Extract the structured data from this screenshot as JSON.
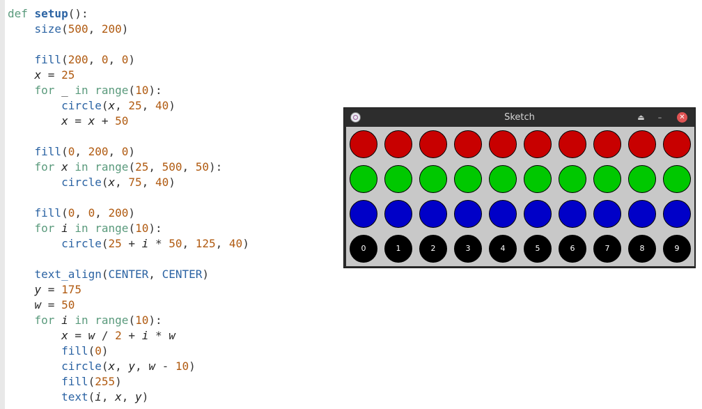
{
  "editor": {
    "lines": [
      [
        {
          "t": "def ",
          "c": "kw"
        },
        {
          "t": "setup",
          "c": "fn"
        },
        {
          "t": "():",
          "c": "plain"
        }
      ],
      [
        {
          "t": "    ",
          "c": "plain"
        },
        {
          "t": "size",
          "c": "bi"
        },
        {
          "t": "(",
          "c": "plain"
        },
        {
          "t": "500",
          "c": "num"
        },
        {
          "t": ", ",
          "c": "plain"
        },
        {
          "t": "200",
          "c": "num"
        },
        {
          "t": ")",
          "c": "plain"
        }
      ],
      [],
      [
        {
          "t": "    ",
          "c": "plain"
        },
        {
          "t": "fill",
          "c": "bi"
        },
        {
          "t": "(",
          "c": "plain"
        },
        {
          "t": "200",
          "c": "num"
        },
        {
          "t": ", ",
          "c": "plain"
        },
        {
          "t": "0",
          "c": "num"
        },
        {
          "t": ", ",
          "c": "plain"
        },
        {
          "t": "0",
          "c": "num"
        },
        {
          "t": ")",
          "c": "plain"
        }
      ],
      [
        {
          "t": "    ",
          "c": "plain"
        },
        {
          "t": "x",
          "c": "var"
        },
        {
          "t": " = ",
          "c": "op"
        },
        {
          "t": "25",
          "c": "num"
        }
      ],
      [
        {
          "t": "    ",
          "c": "plain"
        },
        {
          "t": "for",
          "c": "kw"
        },
        {
          "t": " _ ",
          "c": "plain"
        },
        {
          "t": "in",
          "c": "kw"
        },
        {
          "t": " ",
          "c": "plain"
        },
        {
          "t": "range",
          "c": "kw"
        },
        {
          "t": "(",
          "c": "plain"
        },
        {
          "t": "10",
          "c": "num"
        },
        {
          "t": "):",
          "c": "plain"
        }
      ],
      [
        {
          "t": "        ",
          "c": "plain"
        },
        {
          "t": "circle",
          "c": "bi"
        },
        {
          "t": "(",
          "c": "plain"
        },
        {
          "t": "x",
          "c": "var"
        },
        {
          "t": ", ",
          "c": "plain"
        },
        {
          "t": "25",
          "c": "num"
        },
        {
          "t": ", ",
          "c": "plain"
        },
        {
          "t": "40",
          "c": "num"
        },
        {
          "t": ")",
          "c": "plain"
        }
      ],
      [
        {
          "t": "        ",
          "c": "plain"
        },
        {
          "t": "x",
          "c": "var"
        },
        {
          "t": " = ",
          "c": "op"
        },
        {
          "t": "x",
          "c": "var"
        },
        {
          "t": " + ",
          "c": "op"
        },
        {
          "t": "50",
          "c": "num"
        }
      ],
      [],
      [
        {
          "t": "    ",
          "c": "plain"
        },
        {
          "t": "fill",
          "c": "bi"
        },
        {
          "t": "(",
          "c": "plain"
        },
        {
          "t": "0",
          "c": "num"
        },
        {
          "t": ", ",
          "c": "plain"
        },
        {
          "t": "200",
          "c": "num"
        },
        {
          "t": ", ",
          "c": "plain"
        },
        {
          "t": "0",
          "c": "num"
        },
        {
          "t": ")",
          "c": "plain"
        }
      ],
      [
        {
          "t": "    ",
          "c": "plain"
        },
        {
          "t": "for",
          "c": "kw"
        },
        {
          "t": " ",
          "c": "plain"
        },
        {
          "t": "x",
          "c": "var"
        },
        {
          "t": " ",
          "c": "plain"
        },
        {
          "t": "in",
          "c": "kw"
        },
        {
          "t": " ",
          "c": "plain"
        },
        {
          "t": "range",
          "c": "kw"
        },
        {
          "t": "(",
          "c": "plain"
        },
        {
          "t": "25",
          "c": "num"
        },
        {
          "t": ", ",
          "c": "plain"
        },
        {
          "t": "500",
          "c": "num"
        },
        {
          "t": ", ",
          "c": "plain"
        },
        {
          "t": "50",
          "c": "num"
        },
        {
          "t": "):",
          "c": "plain"
        }
      ],
      [
        {
          "t": "        ",
          "c": "plain"
        },
        {
          "t": "circle",
          "c": "bi"
        },
        {
          "t": "(",
          "c": "plain"
        },
        {
          "t": "x",
          "c": "var"
        },
        {
          "t": ", ",
          "c": "plain"
        },
        {
          "t": "75",
          "c": "num"
        },
        {
          "t": ", ",
          "c": "plain"
        },
        {
          "t": "40",
          "c": "num"
        },
        {
          "t": ")",
          "c": "plain"
        }
      ],
      [],
      [
        {
          "t": "    ",
          "c": "plain"
        },
        {
          "t": "fill",
          "c": "bi"
        },
        {
          "t": "(",
          "c": "plain"
        },
        {
          "t": "0",
          "c": "num"
        },
        {
          "t": ", ",
          "c": "plain"
        },
        {
          "t": "0",
          "c": "num"
        },
        {
          "t": ", ",
          "c": "plain"
        },
        {
          "t": "200",
          "c": "num"
        },
        {
          "t": ")",
          "c": "plain"
        }
      ],
      [
        {
          "t": "    ",
          "c": "plain"
        },
        {
          "t": "for",
          "c": "kw"
        },
        {
          "t": " ",
          "c": "plain"
        },
        {
          "t": "i",
          "c": "var"
        },
        {
          "t": " ",
          "c": "plain"
        },
        {
          "t": "in",
          "c": "kw"
        },
        {
          "t": " ",
          "c": "plain"
        },
        {
          "t": "range",
          "c": "kw"
        },
        {
          "t": "(",
          "c": "plain"
        },
        {
          "t": "10",
          "c": "num"
        },
        {
          "t": "):",
          "c": "plain"
        }
      ],
      [
        {
          "t": "        ",
          "c": "plain"
        },
        {
          "t": "circle",
          "c": "bi"
        },
        {
          "t": "(",
          "c": "plain"
        },
        {
          "t": "25",
          "c": "num"
        },
        {
          "t": " + ",
          "c": "op"
        },
        {
          "t": "i",
          "c": "var"
        },
        {
          "t": " * ",
          "c": "op"
        },
        {
          "t": "50",
          "c": "num"
        },
        {
          "t": ", ",
          "c": "plain"
        },
        {
          "t": "125",
          "c": "num"
        },
        {
          "t": ", ",
          "c": "plain"
        },
        {
          "t": "40",
          "c": "num"
        },
        {
          "t": ")",
          "c": "plain"
        }
      ],
      [],
      [
        {
          "t": "    ",
          "c": "plain"
        },
        {
          "t": "text_align",
          "c": "bi"
        },
        {
          "t": "(",
          "c": "plain"
        },
        {
          "t": "CENTER",
          "c": "con"
        },
        {
          "t": ", ",
          "c": "plain"
        },
        {
          "t": "CENTER",
          "c": "con"
        },
        {
          "t": ")",
          "c": "plain"
        }
      ],
      [
        {
          "t": "    ",
          "c": "plain"
        },
        {
          "t": "y",
          "c": "var"
        },
        {
          "t": " = ",
          "c": "op"
        },
        {
          "t": "175",
          "c": "num"
        }
      ],
      [
        {
          "t": "    ",
          "c": "plain"
        },
        {
          "t": "w",
          "c": "var"
        },
        {
          "t": " = ",
          "c": "op"
        },
        {
          "t": "50",
          "c": "num"
        }
      ],
      [
        {
          "t": "    ",
          "c": "plain"
        },
        {
          "t": "for",
          "c": "kw"
        },
        {
          "t": " ",
          "c": "plain"
        },
        {
          "t": "i",
          "c": "var"
        },
        {
          "t": " ",
          "c": "plain"
        },
        {
          "t": "in",
          "c": "kw"
        },
        {
          "t": " ",
          "c": "plain"
        },
        {
          "t": "range",
          "c": "kw"
        },
        {
          "t": "(",
          "c": "plain"
        },
        {
          "t": "10",
          "c": "num"
        },
        {
          "t": "):",
          "c": "plain"
        }
      ],
      [
        {
          "t": "        ",
          "c": "plain"
        },
        {
          "t": "x",
          "c": "var"
        },
        {
          "t": " = ",
          "c": "op"
        },
        {
          "t": "w",
          "c": "var"
        },
        {
          "t": " / ",
          "c": "op"
        },
        {
          "t": "2",
          "c": "num"
        },
        {
          "t": " + ",
          "c": "op"
        },
        {
          "t": "i",
          "c": "var"
        },
        {
          "t": " * ",
          "c": "op"
        },
        {
          "t": "w",
          "c": "var"
        }
      ],
      [
        {
          "t": "        ",
          "c": "plain"
        },
        {
          "t": "fill",
          "c": "bi"
        },
        {
          "t": "(",
          "c": "plain"
        },
        {
          "t": "0",
          "c": "num"
        },
        {
          "t": ")",
          "c": "plain"
        }
      ],
      [
        {
          "t": "        ",
          "c": "plain"
        },
        {
          "t": "circle",
          "c": "bi"
        },
        {
          "t": "(",
          "c": "plain"
        },
        {
          "t": "x",
          "c": "var"
        },
        {
          "t": ", ",
          "c": "plain"
        },
        {
          "t": "y",
          "c": "var"
        },
        {
          "t": ", ",
          "c": "plain"
        },
        {
          "t": "w",
          "c": "var"
        },
        {
          "t": " - ",
          "c": "op"
        },
        {
          "t": "10",
          "c": "num"
        },
        {
          "t": ")",
          "c": "plain"
        }
      ],
      [
        {
          "t": "        ",
          "c": "plain"
        },
        {
          "t": "fill",
          "c": "bi"
        },
        {
          "t": "(",
          "c": "plain"
        },
        {
          "t": "255",
          "c": "num"
        },
        {
          "t": ")",
          "c": "plain"
        }
      ],
      [
        {
          "t": "        ",
          "c": "plain"
        },
        {
          "t": "text",
          "c": "bi"
        },
        {
          "t": "(",
          "c": "plain"
        },
        {
          "t": "i",
          "c": "var"
        },
        {
          "t": ", ",
          "c": "plain"
        },
        {
          "t": "x",
          "c": "var"
        },
        {
          "t": ", ",
          "c": "plain"
        },
        {
          "t": "y",
          "c": "var"
        },
        {
          "t": ")",
          "c": "plain"
        }
      ]
    ]
  },
  "sketch": {
    "title": "Sketch",
    "icons": {
      "app": "processing-app-icon",
      "shade": "shade-icon",
      "minimize": "minimize-icon",
      "close": "close-icon"
    },
    "buttons": {
      "shade": "⏏",
      "minimize": "–",
      "close": "✕"
    },
    "canvas_size": [
      500,
      200
    ],
    "background": "#c8c8c8",
    "rows": [
      {
        "fill": "#c80000",
        "labels": []
      },
      {
        "fill": "#00c800",
        "labels": []
      },
      {
        "fill": "#0000c8",
        "labels": []
      },
      {
        "fill": "#000000",
        "labels": [
          "0",
          "1",
          "2",
          "3",
          "4",
          "5",
          "6",
          "7",
          "8",
          "9"
        ]
      }
    ]
  }
}
